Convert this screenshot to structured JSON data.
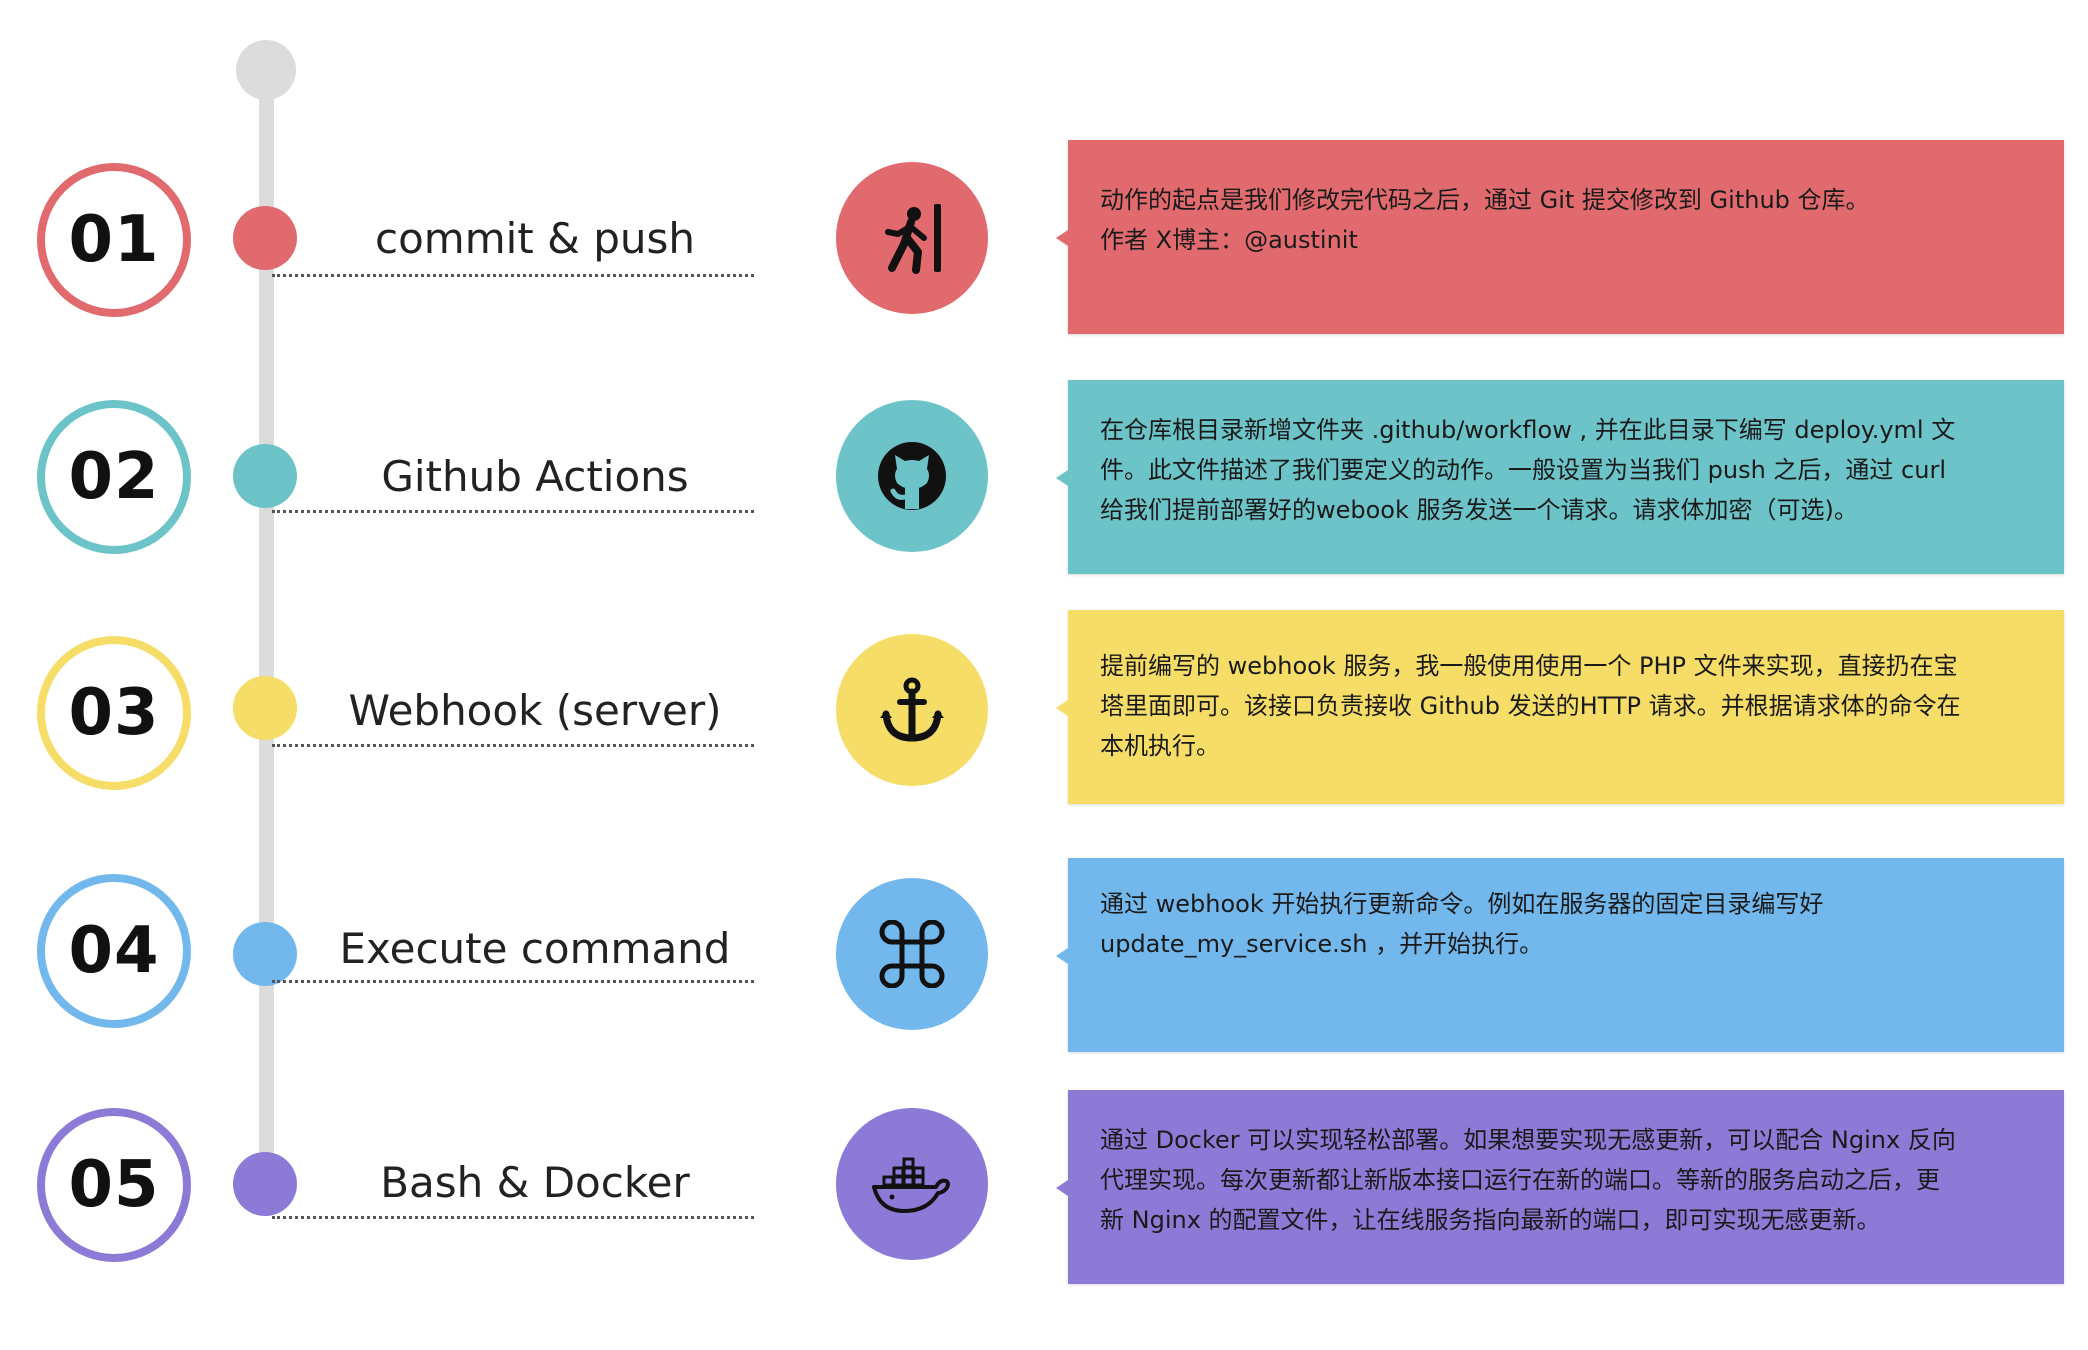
{
  "colors": {
    "red": "#e06a6d",
    "teal": "#6cc3c8",
    "yellow": "#f5dd68",
    "blue": "#72b8ed",
    "purple": "#8c7ad6",
    "timeline": "#dcdcdc"
  },
  "steps": [
    {
      "number": "01",
      "title": "commit & push",
      "color": "#e06a6d",
      "icon": "walking-person-icon",
      "lines": [
        "动作的起点是我们修改完代码之后，通过 Git 提交修改到 Github 仓库。",
        " 作者  X博主：@austinit"
      ]
    },
    {
      "number": "02",
      "title": "Github Actions",
      "color": "#6cc3c8",
      "icon": "github-octocat-icon",
      "lines": [
        "在仓库根目录新增文件夹  .github/workflow , 并在此目录下编写 deploy.yml 文",
        "件。此文件描述了我们要定义的动作。一般设置为当我们 push 之后，通过 curl",
        "给我们提前部署好的webook 服务发送一个请求。请求体加密（可选)。"
      ]
    },
    {
      "number": "03",
      "title": "Webhook (server)",
      "color": "#f5dd68",
      "icon": "anchor-icon",
      "lines": [
        "提前编写的 webhook 服务，我一般使用使用一个 PHP 文件来实现，直接扔在宝",
        "塔里面即可。该接口负责接收 Github 发送的HTTP 请求。并根据请求体的命令在",
        "本机执行。"
      ]
    },
    {
      "number": "04",
      "title": "Execute command",
      "color": "#72b8ed",
      "icon": "command-key-icon",
      "lines": [
        "通过 webhook 开始执行更新命令。例如在服务器的固定目录编写好",
        "update_my_service.sh ，并开始执行。"
      ]
    },
    {
      "number": "05",
      "title": "Bash & Docker",
      "color": "#8c7ad6",
      "icon": "docker-whale-icon",
      "lines": [
        "通过 Docker 可以实现轻松部署。如果想要实现无感更新，可以配合 Nginx 反向",
        "代理实现。每次更新都让新版本接口运行在新的端口。等新的服务启动之后，更",
        "新 Nginx 的配置文件，让在线服务指向最新的端口，即可实现无感更新。"
      ]
    }
  ]
}
